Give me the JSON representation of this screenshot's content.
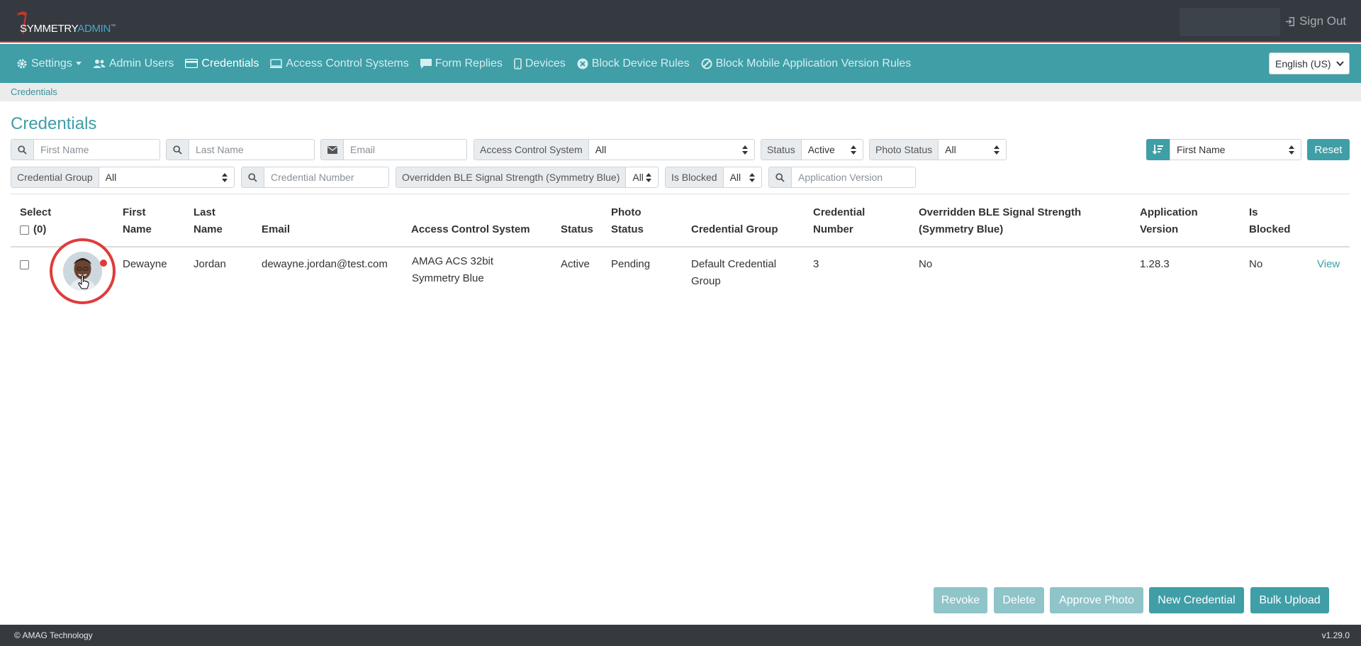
{
  "header": {
    "logo_symmetry": "SYMMETRY",
    "logo_admin": "ADMIN",
    "logo_tm": "™",
    "signout_label": "Sign Out"
  },
  "nav": {
    "items": [
      {
        "label": "Settings",
        "icon": "gear-icon"
      },
      {
        "label": "Admin Users",
        "icon": "users-icon"
      },
      {
        "label": "Credentials",
        "icon": "id-card-icon",
        "active": true
      },
      {
        "label": "Access Control Systems",
        "icon": "monitor-icon"
      },
      {
        "label": "Form Replies",
        "icon": "comment-icon"
      },
      {
        "label": "Devices",
        "icon": "mobile-icon"
      },
      {
        "label": "Block Device Rules",
        "icon": "times-circle-icon"
      },
      {
        "label": "Block Mobile Application Version Rules",
        "icon": "ban-icon"
      }
    ],
    "language": "English (US)"
  },
  "breadcrumb": "Credentials",
  "page_title": "Credentials",
  "filters": {
    "first_name_ph": "First Name",
    "last_name_ph": "Last Name",
    "email_ph": "Email",
    "acs_label": "Access Control System",
    "acs_value": "All",
    "status_label": "Status",
    "status_value": "Active",
    "photo_status_label": "Photo Status",
    "photo_status_value": "All",
    "sort_value": "First Name",
    "reset_label": "Reset",
    "credential_group_label": "Credential Group",
    "credential_group_value": "All",
    "credential_number_ph": "Credential Number",
    "ble_label": "Overridden BLE Signal Strength (Symmetry Blue)",
    "ble_value": "All",
    "is_blocked_label": "Is Blocked",
    "is_blocked_value": "All",
    "app_version_ph": "Application Version"
  },
  "table": {
    "headers": {
      "select": "Select",
      "select_count": "(0)",
      "first_name_1": "First",
      "first_name_2": "Name",
      "last_name_1": "Last",
      "last_name_2": "Name",
      "email": "Email",
      "acs": "Access Control System",
      "status": "Status",
      "photo_status_1": "Photo",
      "photo_status_2": "Status",
      "credential_group": "Credential Group",
      "credential_number_1": "Credential",
      "credential_number_2": "Number",
      "ble_1": "Overridden BLE Signal Strength",
      "ble_2": "(Symmetry Blue)",
      "app_version_1": "Application",
      "app_version_2": "Version",
      "is_blocked_1": "Is",
      "is_blocked_2": "Blocked"
    },
    "rows": [
      {
        "first_name": "Dewayne",
        "last_name": "Jordan",
        "email": "dewayne.jordan@test.com",
        "acs_1": "AMAG ACS 32bit",
        "acs_2": "Symmetry Blue",
        "status": "Active",
        "photo_status": "Pending",
        "credential_group_1": "Default Credential",
        "credential_group_2": "Group",
        "credential_number": "3",
        "ble": "No",
        "app_version": "1.28.3",
        "is_blocked": "No",
        "view_label": "View"
      }
    ]
  },
  "actions": {
    "revoke": "Revoke",
    "delete": "Delete",
    "approve_photo": "Approve Photo",
    "new_credential": "New Credential",
    "bulk_upload": "Bulk Upload"
  },
  "footer": {
    "copyright": "© AMAG Technology",
    "version": "v1.29.0"
  },
  "colors": {
    "teal": "#3f9ea6",
    "dark": "#343a40",
    "alert_red": "#e03b3b"
  }
}
